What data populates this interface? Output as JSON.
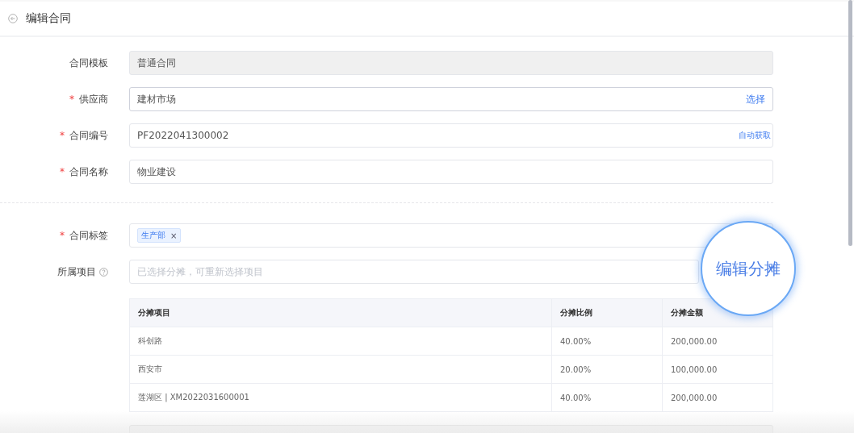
{
  "header": {
    "title": "编辑合同"
  },
  "fields": [
    {
      "kind": "readonly",
      "label": "合同模板",
      "value": "普通合同"
    },
    {
      "kind": "select",
      "label": "供应商",
      "required_mark": "*",
      "value": "建材市场",
      "action": "选择"
    },
    {
      "kind": "autofill",
      "label": "合同编号",
      "required_mark": "*",
      "value": "PF2022041300002",
      "action": "自动获取"
    },
    {
      "kind": "text",
      "label": "合同名称",
      "required_mark": "*",
      "value": "物业建设"
    }
  ],
  "fields_2": [
    {
      "kind": "tags",
      "label": "合同标签",
      "required_mark": "*",
      "tags": [
        {
          "text": "生产部",
          "remove": "×"
        }
      ]
    },
    {
      "kind": "help",
      "label": "所属项目",
      "placeholder": "已选择分摊，可重新选择项目"
    }
  ],
  "allocation_table": {
    "columns": [
      "分摊项目",
      "分摊比例",
      "分摊金额"
    ],
    "rows": [
      [
        "科创路",
        "40.00%",
        "200,000.00"
      ],
      [
        "西安市",
        "20.00%",
        "100,000.00"
      ],
      [
        "莲湖区 | XM2022031600001",
        "40.00%",
        "200,000.00"
      ]
    ]
  },
  "magnifier": {
    "label": "编辑分摊"
  }
}
